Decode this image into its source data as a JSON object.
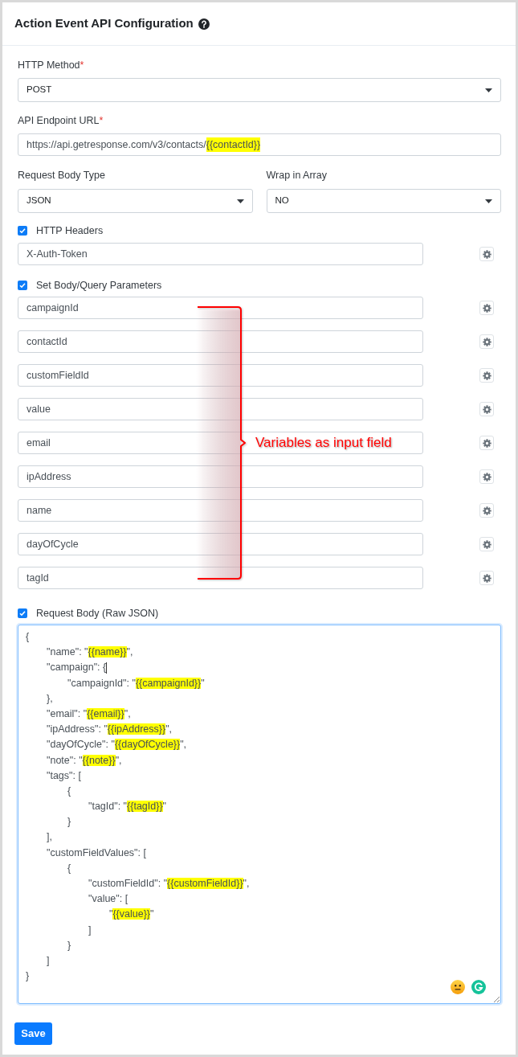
{
  "header": {
    "title": "Action Event API Configuration"
  },
  "http_method": {
    "label": "HTTP Method",
    "required_mark": "*",
    "value": "POST"
  },
  "endpoint": {
    "label": "API Endpoint URL",
    "required_mark": "*",
    "value": [
      {
        "text": "https://api.getresponse.com/v3/contacts/",
        "highlight": false
      },
      {
        "text": "{{contactId}}",
        "highlight": true
      }
    ]
  },
  "request_body_type": {
    "label": "Request Body Type",
    "value": "JSON"
  },
  "wrap_in_array": {
    "label": "Wrap in Array",
    "value": "NO"
  },
  "http_headers": {
    "label": "HTTP Headers",
    "checked": true,
    "items": [
      {
        "value": "X-Auth-Token"
      }
    ]
  },
  "parameters": {
    "label": "Set Body/Query Parameters",
    "checked": true,
    "items": [
      {
        "value": "campaignId"
      },
      {
        "value": "contactId"
      },
      {
        "value": "customFieldId"
      },
      {
        "value": "value"
      },
      {
        "value": "email"
      },
      {
        "value": "ipAddress"
      },
      {
        "value": "name"
      },
      {
        "value": "dayOfCycle"
      },
      {
        "value": "tagId"
      }
    ]
  },
  "annotation": {
    "text": "Variables as input field"
  },
  "request_body": {
    "label": "Request Body (Raw JSON)",
    "checked": true,
    "lines": [
      {
        "caret": false,
        "segments": [
          {
            "text": "{",
            "highlight": false
          }
        ]
      },
      {
        "caret": false,
        "segments": [
          {
            "text": "\t\"name\": \"",
            "highlight": false
          },
          {
            "text": "{{name}}",
            "highlight": true
          },
          {
            "text": "\",",
            "highlight": false
          }
        ]
      },
      {
        "caret": true,
        "segments": [
          {
            "text": "\t\"campaign\": {",
            "highlight": false
          }
        ]
      },
      {
        "caret": false,
        "segments": [
          {
            "text": "\t\t\"campaignId\": \"",
            "highlight": false
          },
          {
            "text": "{{campaignId}}",
            "highlight": true
          },
          {
            "text": "\"",
            "highlight": false
          }
        ]
      },
      {
        "caret": false,
        "segments": [
          {
            "text": "\t},",
            "highlight": false
          }
        ]
      },
      {
        "caret": false,
        "segments": [
          {
            "text": "\t\"email\": \"",
            "highlight": false
          },
          {
            "text": "{{email}}",
            "highlight": true
          },
          {
            "text": "\",",
            "highlight": false
          }
        ]
      },
      {
        "caret": false,
        "segments": [
          {
            "text": "\t\"ipAddress\": \"",
            "highlight": false
          },
          {
            "text": "{{ipAddress}}",
            "highlight": true
          },
          {
            "text": "\",",
            "highlight": false
          }
        ]
      },
      {
        "caret": false,
        "segments": [
          {
            "text": "\t\"dayOfCycle\": \"",
            "highlight": false
          },
          {
            "text": "{{dayOfCycle}}",
            "highlight": true
          },
          {
            "text": "\",",
            "highlight": false
          }
        ]
      },
      {
        "caret": false,
        "segments": [
          {
            "text": "\t\"note\": \"",
            "highlight": false
          },
          {
            "text": "{{note}}",
            "highlight": true
          },
          {
            "text": "\",",
            "highlight": false
          }
        ]
      },
      {
        "caret": false,
        "segments": [
          {
            "text": "\t\"tags\": [",
            "highlight": false
          }
        ]
      },
      {
        "caret": false,
        "segments": [
          {
            "text": "\t\t{",
            "highlight": false
          }
        ]
      },
      {
        "caret": false,
        "segments": [
          {
            "text": "\t\t\t\"tagId\": \"",
            "highlight": false
          },
          {
            "text": "{{tagId}}",
            "highlight": true
          },
          {
            "text": "\"",
            "highlight": false
          }
        ]
      },
      {
        "caret": false,
        "segments": [
          {
            "text": "\t\t}",
            "highlight": false
          }
        ]
      },
      {
        "caret": false,
        "segments": [
          {
            "text": "\t],",
            "highlight": false
          }
        ]
      },
      {
        "caret": false,
        "segments": [
          {
            "text": "\t\"customFieldValues\": [",
            "highlight": false
          }
        ]
      },
      {
        "caret": false,
        "segments": [
          {
            "text": "\t\t{",
            "highlight": false
          }
        ]
      },
      {
        "caret": false,
        "segments": [
          {
            "text": "\t\t\t\"customFieldId\": \"",
            "highlight": false
          },
          {
            "text": "{{customFieldId}}",
            "highlight": true
          },
          {
            "text": "\",",
            "highlight": false
          }
        ]
      },
      {
        "caret": false,
        "segments": [
          {
            "text": "\t\t\t\"value\": [",
            "highlight": false
          }
        ]
      },
      {
        "caret": false,
        "segments": [
          {
            "text": "\t\t\t\t\"",
            "highlight": false
          },
          {
            "text": "{{value}}",
            "highlight": true
          },
          {
            "text": "\"",
            "highlight": false
          }
        ]
      },
      {
        "caret": false,
        "segments": [
          {
            "text": "\t\t\t]",
            "highlight": false
          }
        ]
      },
      {
        "caret": false,
        "segments": [
          {
            "text": "\t\t}",
            "highlight": false
          }
        ]
      },
      {
        "caret": false,
        "segments": [
          {
            "text": "\t]",
            "highlight": false
          }
        ]
      },
      {
        "caret": false,
        "segments": [
          {
            "text": "}",
            "highlight": false
          }
        ]
      }
    ]
  },
  "save_button": {
    "label": "Save"
  }
}
